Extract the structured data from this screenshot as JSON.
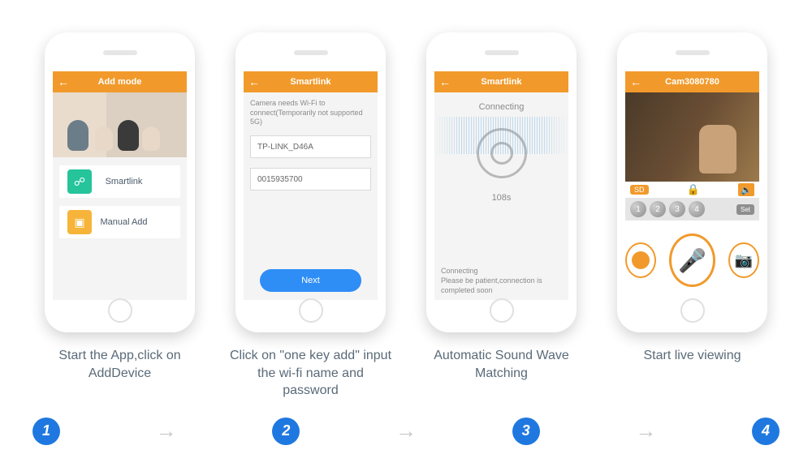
{
  "steps": [
    {
      "titlebar": "Add mode",
      "options": [
        {
          "icon": "link-icon",
          "color": "#26c49b",
          "label": "Smartlink"
        },
        {
          "icon": "manual-icon",
          "color": "#f6b53a",
          "label": "Manual Add"
        }
      ],
      "caption": "Start the App,click on AddDevice"
    },
    {
      "titlebar": "Smartlink",
      "note": "Camera needs Wi-Fi to connect(Temporarily not supported 5G)",
      "ssid": "TP-LINK_D46A",
      "password": "0015935700",
      "next_label": "Next",
      "caption": "Click on \"one key add\" input the wi-fi name and password"
    },
    {
      "titlebar": "Smartlink",
      "status_top": "Connecting",
      "timer": "108s",
      "status_bottom_title": "Connecting",
      "status_bottom_body": "Please be patient,connection is completed soon",
      "caption": "Automatic Sound Wave Matching"
    },
    {
      "titlebar": "Cam3080780",
      "sd_label": "SD",
      "presets": [
        "1",
        "2",
        "3",
        "4"
      ],
      "set_label": "Set",
      "caption": "Start live viewing"
    }
  ],
  "num_labels": [
    "1",
    "2",
    "3",
    "4"
  ],
  "arrow_glyph": "→"
}
